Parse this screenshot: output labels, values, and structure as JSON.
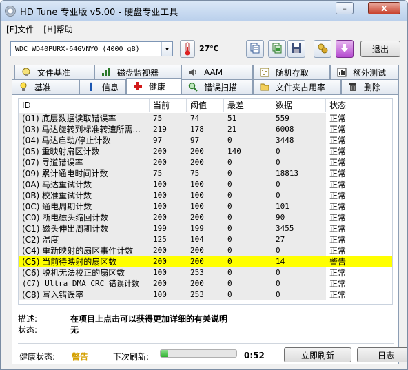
{
  "window": {
    "title": "HD Tune 专业版 v5.00 - 硬盘专业工具",
    "minimize_glyph": "–",
    "close_glyph": "X"
  },
  "menu": [
    {
      "label": "[F]文件"
    },
    {
      "label": "[H]帮助"
    }
  ],
  "toolbar": {
    "drive_select_value": "WDC    WD40PURX-64GVNY0 (4000 gB)",
    "temperature": "27℃",
    "exit_label": "退出",
    "icons": [
      "copy-text-icon",
      "copy-screenshot-icon",
      "save-icon",
      "options-icon",
      "download-icon"
    ]
  },
  "tabs": {
    "row1": [
      {
        "label": "文件基准",
        "icon": "file-benchmark-icon"
      },
      {
        "label": "磁盘监视器",
        "icon": "disk-monitor-icon"
      },
      {
        "label": "AAM",
        "icon": "speaker-icon"
      },
      {
        "label": "随机存取",
        "icon": "random-access-icon"
      },
      {
        "label": "额外测试",
        "icon": "extra-tests-icon"
      }
    ],
    "row2": [
      {
        "label": "基准",
        "icon": "bulb-icon"
      },
      {
        "label": "信息",
        "icon": "info-icon"
      },
      {
        "label": "健康",
        "icon": "health-cross-icon",
        "active": true
      },
      {
        "label": "错误扫描",
        "icon": "magnifier-icon"
      },
      {
        "label": "文件夹占用率",
        "icon": "folder-icon"
      },
      {
        "label": "删除",
        "icon": "trash-icon"
      }
    ]
  },
  "table": {
    "columns": [
      "ID",
      "当前",
      "阈值",
      "最差",
      "数据",
      "状态"
    ],
    "rows": [
      {
        "id": "(01) 底层数据读取错误率",
        "current": "75",
        "threshold": "74",
        "worst": "51",
        "data": "559",
        "status": "正常"
      },
      {
        "id": "(03) 马达旋转到标准转速所需...",
        "current": "219",
        "threshold": "178",
        "worst": "21",
        "data": "6008",
        "status": "正常"
      },
      {
        "id": "(04) 马达启动/停止计数",
        "current": "97",
        "threshold": "97",
        "worst": "0",
        "data": "3448",
        "status": "正常"
      },
      {
        "id": "(05) 重映射扇区计数",
        "current": "200",
        "threshold": "200",
        "worst": "140",
        "data": "0",
        "status": "正常"
      },
      {
        "id": "(07) 寻道错误率",
        "current": "200",
        "threshold": "200",
        "worst": "0",
        "data": "0",
        "status": "正常"
      },
      {
        "id": "(09) 累计通电时间计数",
        "current": "75",
        "threshold": "75",
        "worst": "0",
        "data": "18813",
        "status": "正常"
      },
      {
        "id": "(0A) 马达重试计数",
        "current": "100",
        "threshold": "100",
        "worst": "0",
        "data": "0",
        "status": "正常"
      },
      {
        "id": "(0B) 校准重试计数",
        "current": "100",
        "threshold": "100",
        "worst": "0",
        "data": "0",
        "status": "正常"
      },
      {
        "id": "(0C) 通电周期计数",
        "current": "100",
        "threshold": "100",
        "worst": "0",
        "data": "101",
        "status": "正常"
      },
      {
        "id": "(C0) 断电磁头缩回计数",
        "current": "200",
        "threshold": "200",
        "worst": "0",
        "data": "90",
        "status": "正常"
      },
      {
        "id": "(C1) 磁头伸出周期计数",
        "current": "199",
        "threshold": "199",
        "worst": "0",
        "data": "3455",
        "status": "正常"
      },
      {
        "id": "(C2) 温度",
        "current": "125",
        "threshold": "104",
        "worst": "0",
        "data": "27",
        "status": "正常"
      },
      {
        "id": "(C4) 重新映射的扇区事件计数",
        "current": "200",
        "threshold": "200",
        "worst": "0",
        "data": "0",
        "status": "正常"
      },
      {
        "id": "(C5) 当前待映射的扇区数",
        "current": "200",
        "threshold": "200",
        "worst": "0",
        "data": "14",
        "status": "警告",
        "warning": true
      },
      {
        "id": "(C6) 脱机无法校正的扇区数",
        "current": "100",
        "threshold": "253",
        "worst": "0",
        "data": "0",
        "status": "正常"
      },
      {
        "id": "(C7) Ultra DMA CRC 错误计数",
        "current": "200",
        "threshold": "200",
        "worst": "0",
        "data": "0",
        "status": "正常"
      },
      {
        "id": "(C8) 写入错误率",
        "current": "100",
        "threshold": "253",
        "worst": "0",
        "data": "0",
        "status": "正常"
      }
    ]
  },
  "details": {
    "desc_label": "描述:",
    "desc_value": "在项目上点击可以获得更加详细的有关说明",
    "state_label": "状态:",
    "state_value": "无"
  },
  "footer": {
    "health_label": "健康状态:",
    "health_value": "警告",
    "health_color": "#d4a000",
    "refresh_label": "下次刷新:",
    "refresh_progress": 0.1,
    "refresh_time": "0:52",
    "refresh_button": "立即刷新",
    "log_button": "日志"
  }
}
